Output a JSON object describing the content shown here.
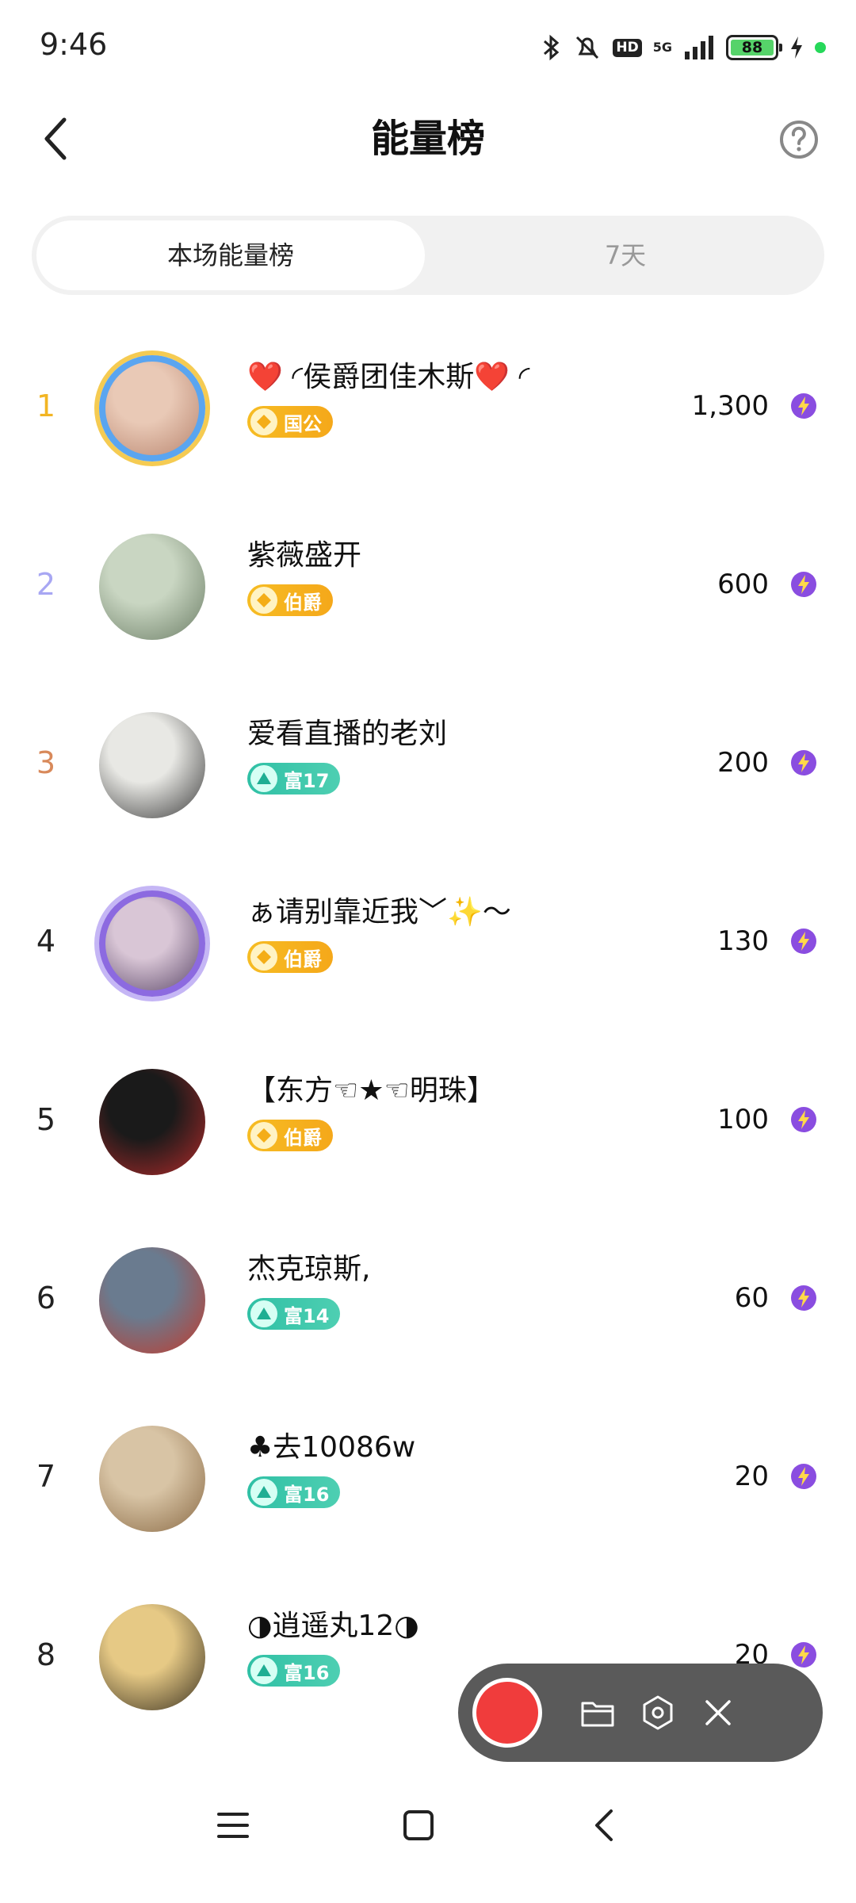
{
  "status_bar": {
    "time": "9:46",
    "network": "5G",
    "hd": "HD",
    "battery": "88"
  },
  "header": {
    "title": "能量榜"
  },
  "tabs": [
    {
      "label": "本场能量榜",
      "active": true
    },
    {
      "label": "7天",
      "active": false
    }
  ],
  "ranking": [
    {
      "rank": "1",
      "name": "❤️ ◜侯爵团佳木斯❤️ ◜",
      "badge": "国公",
      "badge_type": "gold",
      "score": "1,300",
      "avatar_colors": [
        "#e9c9b6",
        "#b98670"
      ]
    },
    {
      "rank": "2",
      "name": "紫薇盛开",
      "badge": "伯爵",
      "badge_type": "gold",
      "score": "600",
      "avatar_colors": [
        "#c9d6c2",
        "#6b7d65"
      ]
    },
    {
      "rank": "3",
      "name": "爱看直播的老刘",
      "badge": "富17",
      "badge_type": "teal",
      "score": "200",
      "avatar_colors": [
        "#e8e8e4",
        "#3b3b3b"
      ]
    },
    {
      "rank": "4",
      "name": "ぁ请别靠近我﹀✨～",
      "badge": "伯爵",
      "badge_type": "gold",
      "score": "130",
      "avatar_colors": [
        "#d9c6d6",
        "#5e4a6b"
      ]
    },
    {
      "rank": "5",
      "name": "【东方☜★☜明珠】",
      "badge": "伯爵",
      "badge_type": "gold",
      "score": "100",
      "avatar_colors": [
        "#1a1a1a",
        "#b22a2a"
      ]
    },
    {
      "rank": "6",
      "name": "杰克琼斯,",
      "badge": "富14",
      "badge_type": "teal",
      "score": "60",
      "avatar_colors": [
        "#6a7b8f",
        "#c23a2c"
      ]
    },
    {
      "rank": "7",
      "name": "♣去10086w",
      "badge": "富16",
      "badge_type": "teal",
      "score": "20",
      "avatar_colors": [
        "#d8c4a5",
        "#8a6a45"
      ]
    },
    {
      "rank": "8",
      "name": "◑逍遥丸12◑",
      "badge": "富16",
      "badge_type": "teal",
      "score": "20",
      "avatar_colors": [
        "#e6c985",
        "#3a3120"
      ]
    }
  ],
  "colors": {
    "rank1": "#f2b523",
    "rank2": "#a8a7f3",
    "rank3": "#d8895a",
    "badge_gold": "#f6bc23",
    "badge_teal": "#2fc0a5",
    "energy": "#8a4de0",
    "record": "#f03c3c"
  },
  "icons": {
    "back": "chevron-left-icon",
    "help": "question-circle-icon",
    "energy": "lightning-icon",
    "recorder": [
      "record-icon",
      "folder-icon",
      "settings-hex-icon",
      "close-icon"
    ],
    "nav": [
      "menu-icon",
      "home-square-icon",
      "back-triangle-icon"
    ]
  }
}
